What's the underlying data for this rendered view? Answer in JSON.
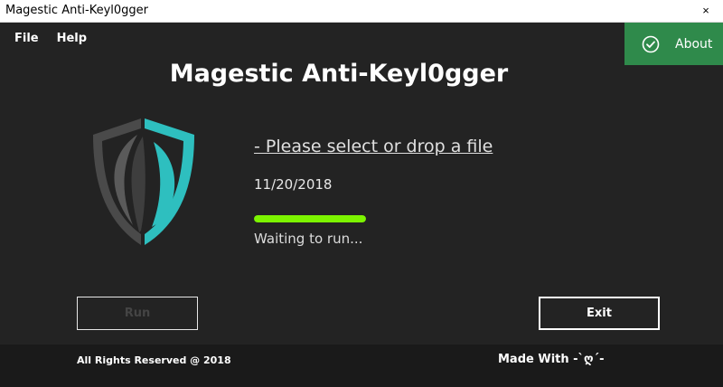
{
  "window": {
    "title": "Magestic Anti-Keyl0gger",
    "close_label": "×"
  },
  "menu": {
    "items": [
      {
        "label": "File"
      },
      {
        "label": "Help"
      }
    ]
  },
  "about": {
    "label": "About",
    "icon": "check-circle-icon",
    "color": "#2f8a4b"
  },
  "app_title": "Magestic Anti-Keyl0gger",
  "logo": {
    "icon": "shield-icon",
    "accent_color": "#2ebfbf",
    "body_color": "#4a4a4a"
  },
  "file_select": {
    "label": "- Please select or drop a file"
  },
  "date": "11/20/2018",
  "progress": {
    "fraction": 1.0,
    "color": "#7cf400"
  },
  "status": "Waiting to run...",
  "buttons": {
    "run": "Run",
    "exit": "Exit"
  },
  "footer": {
    "rights": "All Rights Reserved @ 2018",
    "made_with": "Made With -`ღ´-"
  }
}
